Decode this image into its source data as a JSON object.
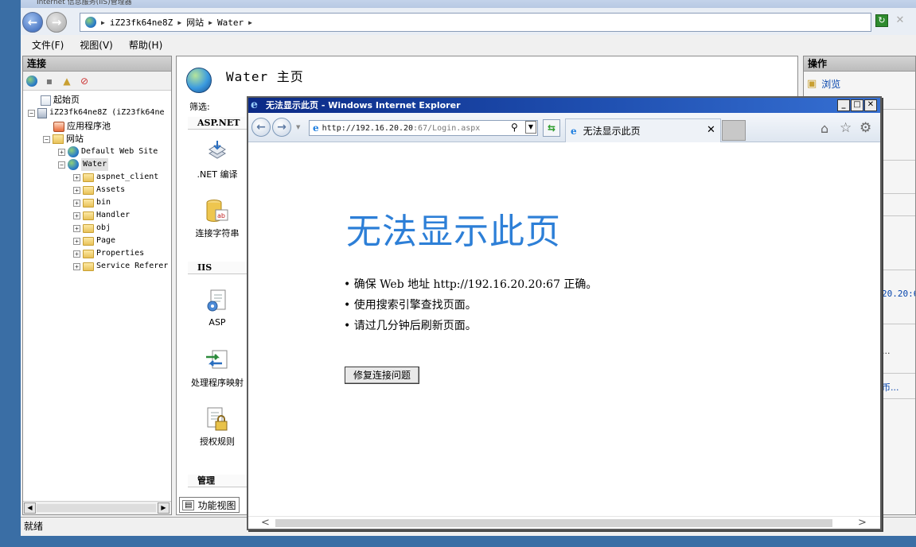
{
  "iis": {
    "title": "Internet 信息服务(IIS)管理器",
    "breadcrumb": [
      "iZ23fk64ne8Z",
      "网站",
      "Water"
    ],
    "menu": [
      "文件(F)",
      "视图(V)",
      "帮助(H)"
    ],
    "connections_header": "连接",
    "tree": {
      "start_page": "起始页",
      "server": "iZ23fk64ne8Z (iZ23fk64ne",
      "app_pools": "应用程序池",
      "sites": "网站",
      "default_site": "Default Web Site",
      "water": "Water",
      "folders": [
        "aspnet_client",
        "Assets",
        "bin",
        "Handler",
        "obj",
        "Page",
        "Properties",
        "Service Referer"
      ]
    },
    "center_title": "Water 主页",
    "filter_label": "筛选:",
    "groups": {
      "aspnet": "ASP.NET",
      "iis": "IIS",
      "manage": "管理"
    },
    "features": {
      "net_compile": ".NET 编译",
      "conn_strings": "连接字符串",
      "asp": "ASP",
      "handler_mappings": "处理程序映射",
      "authz_rules": "授权规则"
    },
    "features_view_tab": "功能视图",
    "actions_header": "操作",
    "actions": {
      "browse": "浏览",
      "frag_ip": "20.20:6",
      "frag_dots": "...",
      "frag_cut": "币..."
    },
    "status": "就绪"
  },
  "ie": {
    "title": "无法显示此页 - Windows Internet Explorer",
    "url_host": "http://192.16.20.20",
    "url_path": ":67/Login.aspx",
    "tab_title": "无法显示此页",
    "heading": "无法显示此页",
    "bullets": [
      "• 确保 Web 地址 http://192.16.20.20:67 正确。",
      "• 使用搜索引擎查找页面。",
      "• 请过几分钟后刷新页面。"
    ],
    "fix_button": "修复连接问题"
  }
}
